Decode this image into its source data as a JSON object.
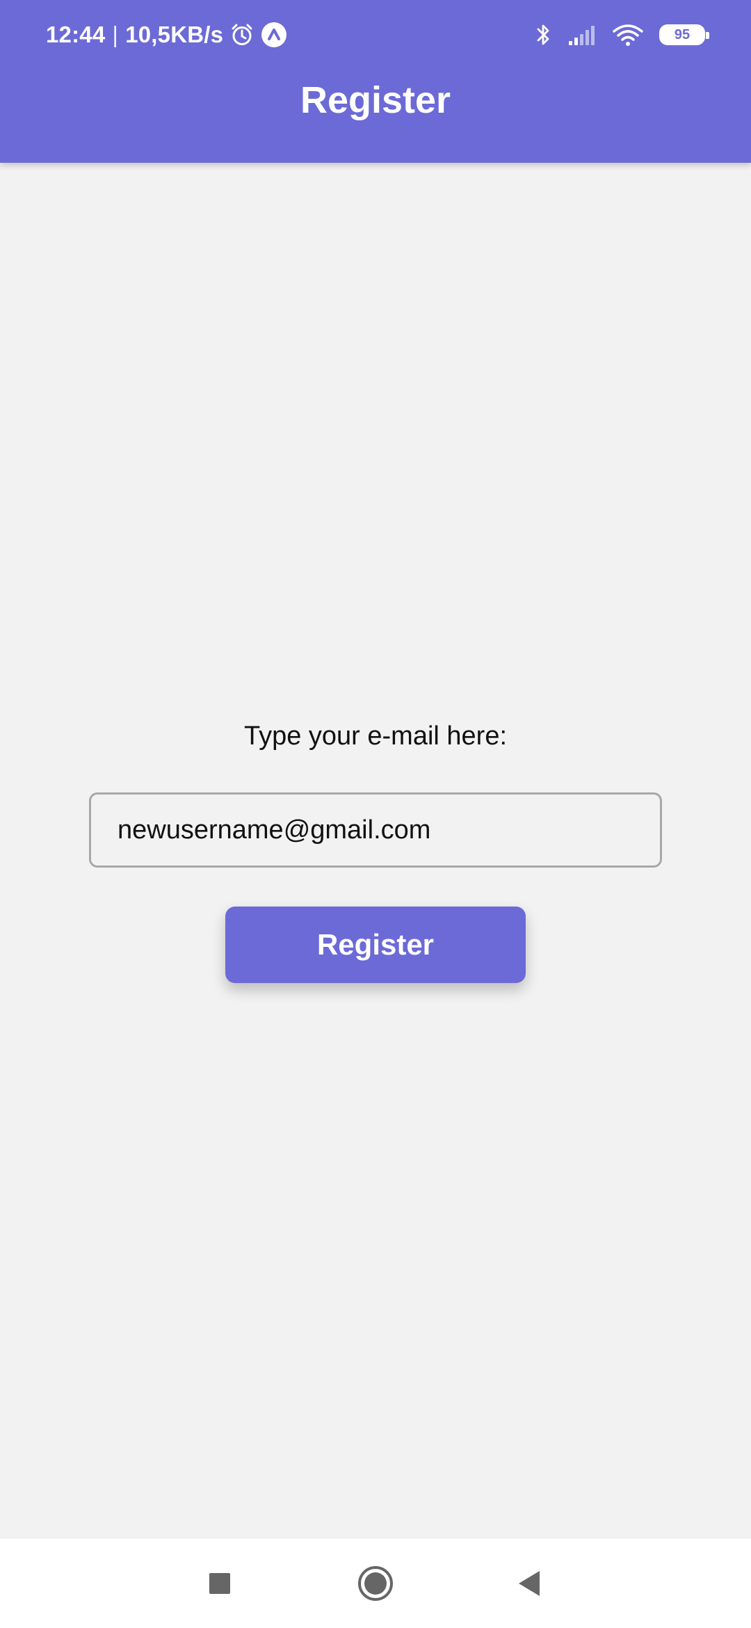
{
  "status_bar": {
    "time": "12:44",
    "separator": "|",
    "network_speed": "10,5KB/s",
    "battery_level": "95",
    "icons": [
      "alarm-icon",
      "app-notification-icon",
      "bluetooth-icon",
      "signal-icon",
      "wifi-icon",
      "battery-icon"
    ]
  },
  "app_bar": {
    "title": "Register"
  },
  "form": {
    "label": "Type your e-mail here:",
    "email_value": "newusername@gmail.com",
    "submit_label": "Register"
  },
  "nav_bar": {
    "icons": [
      "recents-square-icon",
      "home-circle-icon",
      "back-triangle-icon"
    ]
  },
  "colors": {
    "primary": "#6c6ad6",
    "background": "#f2f2f2",
    "input_border": "#a8a8a8"
  }
}
